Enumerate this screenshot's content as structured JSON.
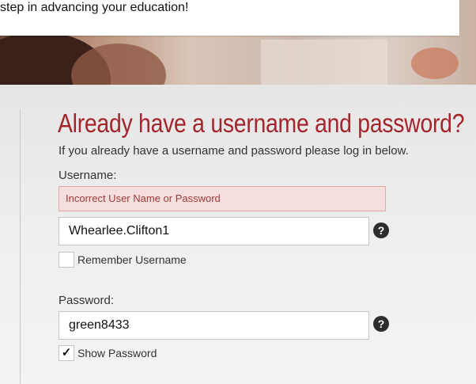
{
  "hero": {
    "text": "step in advancing your education!"
  },
  "login": {
    "title": "Already have a username and password?",
    "subtitle": "If you already have a username and password please log in below.",
    "username_label": "Username:",
    "error_message": "Incorrect User Name or Password",
    "username_value": "Whearlee.Clifton1",
    "remember_label": "Remember Username",
    "remember_checked": false,
    "password_label": "Password:",
    "password_value": "green8433",
    "show_password_label": "Show Password",
    "show_password_checked": true,
    "help_glyph": "?",
    "check_glyph": "✓"
  },
  "colors": {
    "title": "#a4262c",
    "error_bg": "#f6dede",
    "error_text": "#9e3a3a"
  },
  "icons": {
    "help": "question-circle-icon",
    "check": "checkmark-icon"
  }
}
